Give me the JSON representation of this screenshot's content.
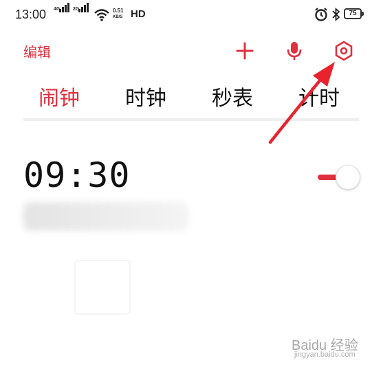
{
  "status_bar": {
    "time": "13:00",
    "signal_1_tag": "4G",
    "signal_2_tag": "2G",
    "net_speed_value": "0.51",
    "net_speed_unit": "KB/S",
    "hd_label": "HD",
    "battery_level": "75",
    "icons": [
      "signal-icon",
      "wifi-icon",
      "alarm-clock-icon",
      "bluetooth-icon",
      "battery-icon"
    ]
  },
  "toolbar": {
    "edit_label": "编辑",
    "icons": [
      "plus-icon",
      "microphone-icon",
      "settings-hexagon-icon"
    ]
  },
  "tabs": [
    {
      "label": "闹钟",
      "active": true
    },
    {
      "label": "时钟",
      "active": false
    },
    {
      "label": "秒表",
      "active": false
    },
    {
      "label": "计时",
      "active": false
    }
  ],
  "alarms": [
    {
      "time": "09:30",
      "description": "",
      "enabled": true
    }
  ],
  "watermark": {
    "logo": "Baidu 经验",
    "url": "jingyan.baidu.com"
  },
  "colors": {
    "accent": "#e0303d",
    "text": "#111111",
    "divider": "#efefef",
    "annotation_arrow": "#e8232e"
  }
}
